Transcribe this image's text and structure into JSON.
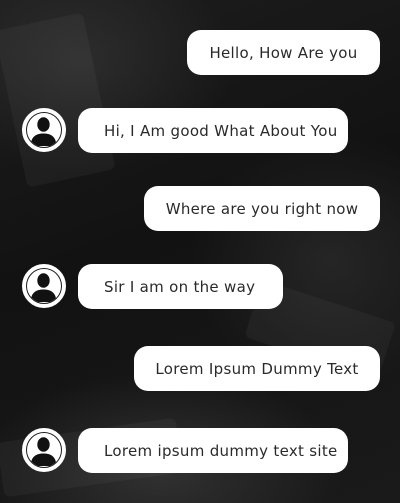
{
  "chat": {
    "messages": [
      {
        "direction": "outgoing",
        "text": "Hello, How Are you"
      },
      {
        "direction": "incoming",
        "text": "Hi, I Am good What About You",
        "avatar_icon": "user-silhouette-icon"
      },
      {
        "direction": "outgoing",
        "text": "Where are you right now"
      },
      {
        "direction": "incoming",
        "text": "Sir I am on the way",
        "avatar_icon": "user-silhouette-icon"
      },
      {
        "direction": "outgoing",
        "text": "Lorem Ipsum Dummy Text"
      },
      {
        "direction": "incoming",
        "text": "Lorem ipsum dummy text site",
        "avatar_icon": "user-silhouette-icon"
      }
    ]
  },
  "colors": {
    "bubble_background": "#ffffff",
    "bubble_text": "#2a2a2a",
    "page_background": "#131313"
  }
}
